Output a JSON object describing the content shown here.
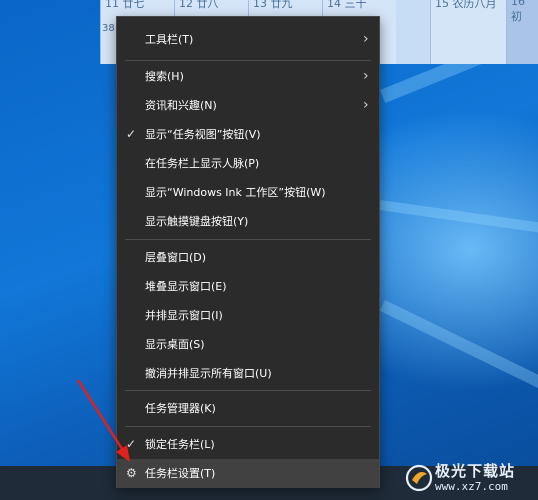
{
  "calendar": {
    "cells": [
      "11 廿七",
      "12 廿八",
      "13 廿九",
      "14 三十",
      "15 农历八月",
      "16 初"
    ],
    "left_number": "38"
  },
  "menu": {
    "items": [
      {
        "label": "工具栏(T)",
        "submenu": true,
        "checked": false
      },
      {
        "label": "搜索(H)",
        "submenu": true,
        "checked": false
      },
      {
        "label": "资讯和兴趣(N)",
        "submenu": true,
        "checked": false
      },
      {
        "label": "显示“任务视图”按钮(V)",
        "submenu": false,
        "checked": true
      },
      {
        "label": "在任务栏上显示人脉(P)",
        "submenu": false,
        "checked": false
      },
      {
        "label": "显示“Windows Ink 工作区”按钮(W)",
        "submenu": false,
        "checked": false
      },
      {
        "label": "显示触摸键盘按钮(Y)",
        "submenu": false,
        "checked": false
      },
      {
        "label": "层叠窗口(D)",
        "submenu": false,
        "checked": false
      },
      {
        "label": "堆叠显示窗口(E)",
        "submenu": false,
        "checked": false
      },
      {
        "label": "并排显示窗口(I)",
        "submenu": false,
        "checked": false
      },
      {
        "label": "显示桌面(S)",
        "submenu": false,
        "checked": false
      },
      {
        "label": "撤消并排显示所有窗口(U)",
        "submenu": false,
        "checked": false
      },
      {
        "label": "任务管理器(K)",
        "submenu": false,
        "checked": false
      },
      {
        "label": "锁定任务栏(L)",
        "submenu": false,
        "checked": true
      },
      {
        "label": "任务栏设置(T)",
        "submenu": false,
        "checked": false,
        "icon": "gear-icon",
        "highlighted": true
      }
    ]
  },
  "icons": {
    "check": "✓",
    "chevron": "›",
    "gear": "⚙"
  },
  "watermark": {
    "title": "极光下载站",
    "url": "www.xz7.com"
  },
  "colors": {
    "menu_bg": "#2b2b2b",
    "hover_bg": "#414141",
    "arrow": "#e0201c",
    "taskbar": "#1f2b38"
  }
}
